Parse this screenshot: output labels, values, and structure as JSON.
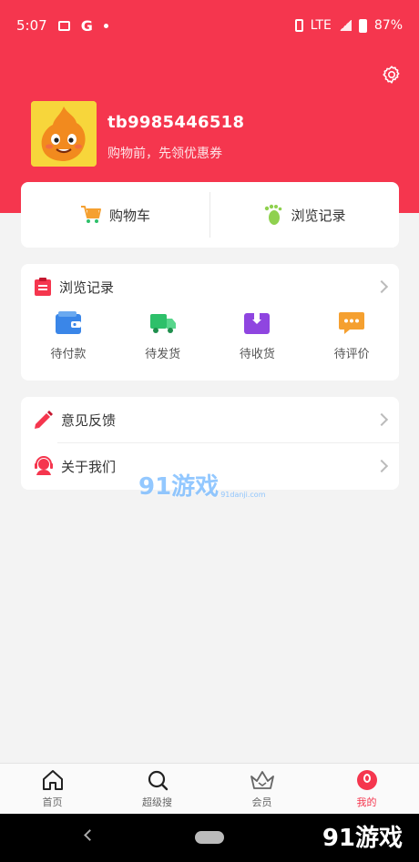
{
  "status_bar": {
    "time": "5:07",
    "google_glyph": "G",
    "network": "LTE",
    "battery": "87%",
    "icons": [
      "image-icon",
      "google-icon",
      "dot-icon",
      "vibrate-icon",
      "signal-icon",
      "battery-icon"
    ]
  },
  "theme": {
    "accent": "#f5364e",
    "background": "#f3f3f3",
    "card": "#ffffff"
  },
  "profile": {
    "username": "tb9985446518",
    "tagline": "购物前，先领优惠券"
  },
  "quick_links": [
    {
      "label": "购物车",
      "icon": "shopping-cart-icon"
    },
    {
      "label": "浏览记录",
      "icon": "footprint-icon"
    }
  ],
  "orders_section": {
    "title": "浏览记录",
    "icon": "clipboard-icon",
    "items": [
      {
        "label": "待付款",
        "icon": "wallet-icon",
        "color": "#3a86e8"
      },
      {
        "label": "待发货",
        "icon": "truck-icon",
        "color": "#2ec06a"
      },
      {
        "label": "待收货",
        "icon": "package-icon",
        "color": "#8f45e0"
      },
      {
        "label": "待评价",
        "icon": "comment-icon",
        "color": "#f5a030"
      }
    ]
  },
  "misc_section": [
    {
      "label": "意见反馈",
      "icon": "pencil-icon"
    },
    {
      "label": "关于我们",
      "icon": "support-agent-icon"
    }
  ],
  "watermark": {
    "text": "91游戏",
    "sub": "91danji.com"
  },
  "tabbar": [
    {
      "label": "首页",
      "icon": "home-icon",
      "active": false
    },
    {
      "label": "超级搜",
      "icon": "search-icon",
      "active": false
    },
    {
      "label": "会员",
      "icon": "crown-icon",
      "active": false
    },
    {
      "label": "我的",
      "icon": "profile-icon",
      "active": true
    }
  ],
  "watermark_corner": "91游戏"
}
